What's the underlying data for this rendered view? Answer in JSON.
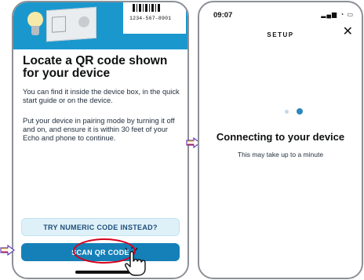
{
  "left_screen": {
    "qr_label_code": "1234-567-8901",
    "title": "Locate a QR code shown for your device",
    "paragraph_1": "You can find it inside the device box, in the quick start guide or on the device.",
    "paragraph_2": "Put your device in pairing mode by turning it off and on, and ensure it is within 30 feet of your Echo and phone to continue.",
    "numeric_button_label": "TRY NUMERIC CODE INSTEAD?",
    "scan_button_label": "SCAN QR CODE",
    "icons": [
      "light-bulb-icon",
      "quick-start-guide-icon",
      "hand-pointer-icon"
    ]
  },
  "right_screen": {
    "status_time": "09:07",
    "status_icons": "▂▄▆ ◔ ▭",
    "header_title": "SETUP",
    "close_symbol": "✕",
    "connecting_title": "Connecting to your device",
    "connecting_subtitle": "This may take up to a minute"
  },
  "annotations": {
    "arrow_icon": "arrow-right-icon",
    "highlight_color": "#d6001c"
  },
  "colors": {
    "header_blue": "#1a98ce",
    "primary_button": "#1580b8",
    "secondary_button": "#dff1f8",
    "progress_dot_active": "#2c87bd",
    "progress_dot_inactive": "#c3d8e6"
  }
}
